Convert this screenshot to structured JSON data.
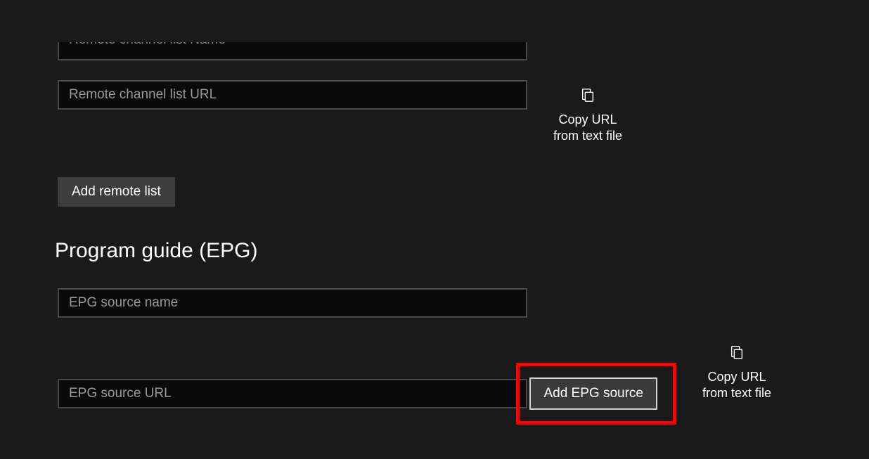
{
  "remote": {
    "name_placeholder": "Remote channel list Name",
    "url_placeholder": "Remote channel list URL",
    "add_button": "Add remote list"
  },
  "copy": {
    "label": "Copy URL from text file"
  },
  "epg": {
    "heading": "Program guide (EPG)",
    "name_placeholder": "EPG source name",
    "url_placeholder": "EPG source URL",
    "add_button": "Add EPG source"
  }
}
